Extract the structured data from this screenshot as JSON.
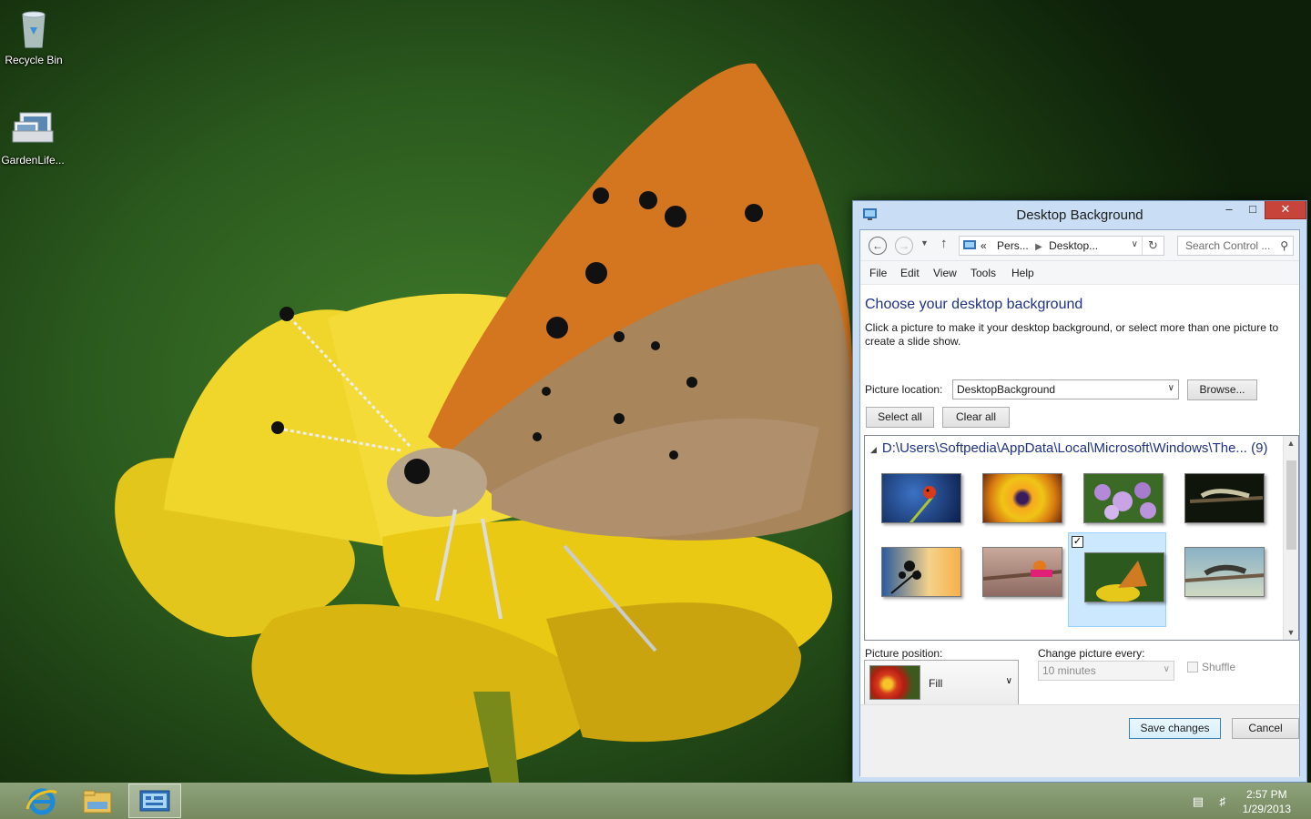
{
  "desktop": {
    "icons": [
      {
        "label": "Recycle Bin",
        "icon": "recycle-bin-icon"
      },
      {
        "label": "GardenLife...",
        "icon": "theme-pack-icon"
      }
    ]
  },
  "window": {
    "title": "Desktop Background",
    "controls": {
      "minimize": "–",
      "maximize": "□",
      "close": "✕"
    },
    "breadcrumb": {
      "overflow": "«",
      "items": [
        "Pers...",
        "Desktop..."
      ]
    },
    "search_placeholder": "Search Control ...",
    "menu": [
      "File",
      "Edit",
      "View",
      "Tools",
      "Help"
    ],
    "heading": "Choose your desktop background",
    "description": "Click a picture to make it your desktop background, or select more than one picture to create a slide show.",
    "picture_location_label": "Picture location:",
    "picture_location_value": "DesktopBackground",
    "browse_label": "Browse...",
    "select_all_label": "Select all",
    "clear_all_label": "Clear all",
    "group": {
      "path": "D:\\Users\\Softpedia\\AppData\\Local\\Microsoft\\Windows\\The...",
      "count": "(9)"
    },
    "thumbnails": [
      {
        "subject": "ladybug-blue",
        "selected": false
      },
      {
        "subject": "sunflower",
        "selected": false
      },
      {
        "subject": "purple-flowers",
        "selected": false
      },
      {
        "subject": "caterpillar-dark",
        "selected": false
      },
      {
        "subject": "rosehip-sunset",
        "selected": false
      },
      {
        "subject": "ladybug-branch",
        "selected": false
      },
      {
        "subject": "butterfly-yellow",
        "selected": true
      },
      {
        "subject": "caterpillar-branch",
        "selected": false
      }
    ],
    "picture_position_label": "Picture position:",
    "picture_position_value": "Fill",
    "change_every_label": "Change picture every:",
    "change_every_value": "10 minutes",
    "shuffle_label": "Shuffle",
    "shuffle_checked": false,
    "save_label": "Save changes",
    "cancel_label": "Cancel"
  },
  "taskbar": {
    "apps": [
      "internet-explorer-icon",
      "file-explorer-icon",
      "control-panel-icon"
    ],
    "active_app": "control-panel-icon",
    "time": "2:57 PM",
    "date": "1/29/2013"
  }
}
